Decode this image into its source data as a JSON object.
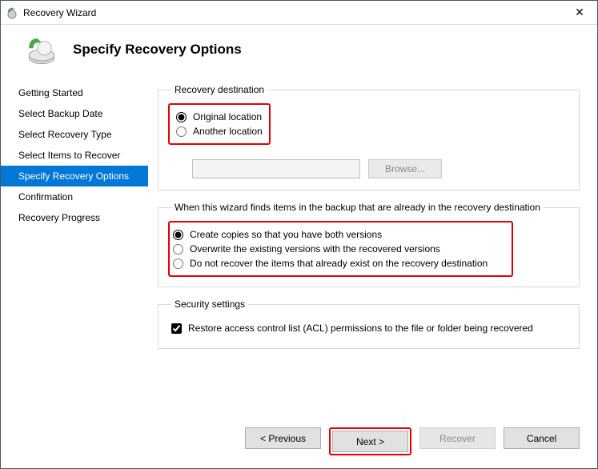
{
  "window": {
    "title": "Recovery Wizard",
    "close_symbol": "✕"
  },
  "header": {
    "heading": "Specify Recovery Options"
  },
  "sidebar": {
    "items": [
      {
        "label": "Getting Started"
      },
      {
        "label": "Select Backup Date"
      },
      {
        "label": "Select Recovery Type"
      },
      {
        "label": "Select Items to Recover"
      },
      {
        "label": "Specify Recovery Options",
        "active": true
      },
      {
        "label": "Confirmation"
      },
      {
        "label": "Recovery Progress"
      }
    ]
  },
  "destination": {
    "legend": "Recovery destination",
    "options": {
      "original": "Original location",
      "another": "Another location"
    },
    "path_value": "",
    "browse_label": "Browse..."
  },
  "conflict": {
    "legend": "When this wizard finds items in the backup that are already in the recovery destination",
    "options": {
      "copies": "Create copies so that you have both versions",
      "overwrite": "Overwrite the existing versions with the recovered versions",
      "skip": "Do not recover the items that already exist on the recovery destination"
    }
  },
  "security": {
    "legend": "Security settings",
    "restore_acl": "Restore access control list (ACL) permissions to the file or folder being recovered"
  },
  "footer": {
    "previous": "< Previous",
    "next": "Next >",
    "recover": "Recover",
    "cancel": "Cancel"
  }
}
